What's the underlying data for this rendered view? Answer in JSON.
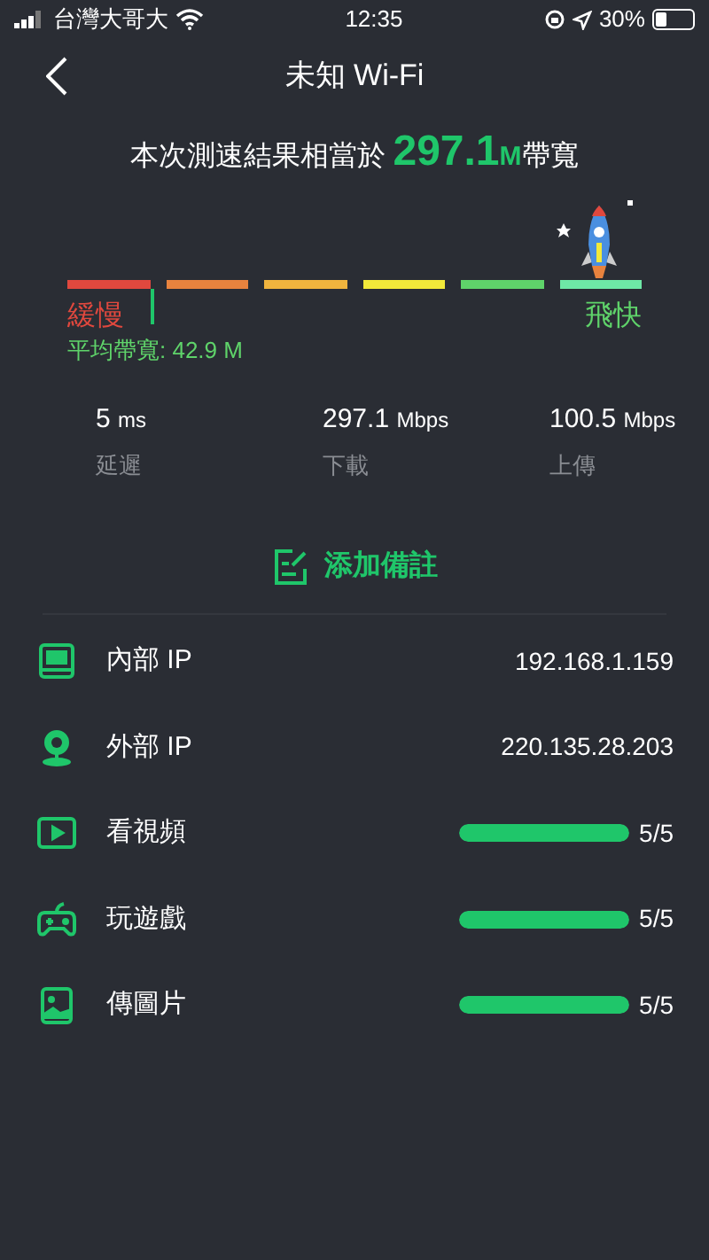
{
  "status_bar": {
    "carrier": "台灣大哥大",
    "time": "12:35",
    "battery": "30%"
  },
  "header": {
    "title": "未知 Wi-Fi"
  },
  "headline": {
    "prefix": "本次測速結果相當於",
    "value": "297.1",
    "unit": "M",
    "suffix": "帶寬"
  },
  "scale": {
    "segments": [
      {
        "color": "#e0483e"
      },
      {
        "color": "#e8833e"
      },
      {
        "color": "#f0b43e"
      },
      {
        "color": "#f2e93a"
      },
      {
        "color": "#5fd36a"
      },
      {
        "color": "#6ee8a6"
      }
    ],
    "slow_label": "緩慢",
    "fast_label": "飛快",
    "average_label": "平均帶寬: 42.9 M"
  },
  "stats": [
    {
      "value": "5",
      "unit": "ms",
      "label": "延遲"
    },
    {
      "value": "297.1",
      "unit": "Mbps",
      "label": "下載"
    },
    {
      "value": "100.5",
      "unit": "Mbps",
      "label": "上傳"
    }
  ],
  "note_button": {
    "label": "添加備註"
  },
  "rows": [
    {
      "kind": "ip",
      "label": "內部 IP",
      "value": "192.168.1.159"
    },
    {
      "kind": "ip",
      "label": "外部 IP",
      "value": "220.135.28.203"
    },
    {
      "kind": "meter",
      "label": "看視頻",
      "level": 1,
      "reading": "5/5"
    },
    {
      "kind": "meter",
      "label": "玩遊戲",
      "level": 1,
      "reading": "5/5"
    },
    {
      "kind": "meter",
      "label": "傳圖片",
      "level": 1,
      "reading": "5/5"
    }
  ]
}
